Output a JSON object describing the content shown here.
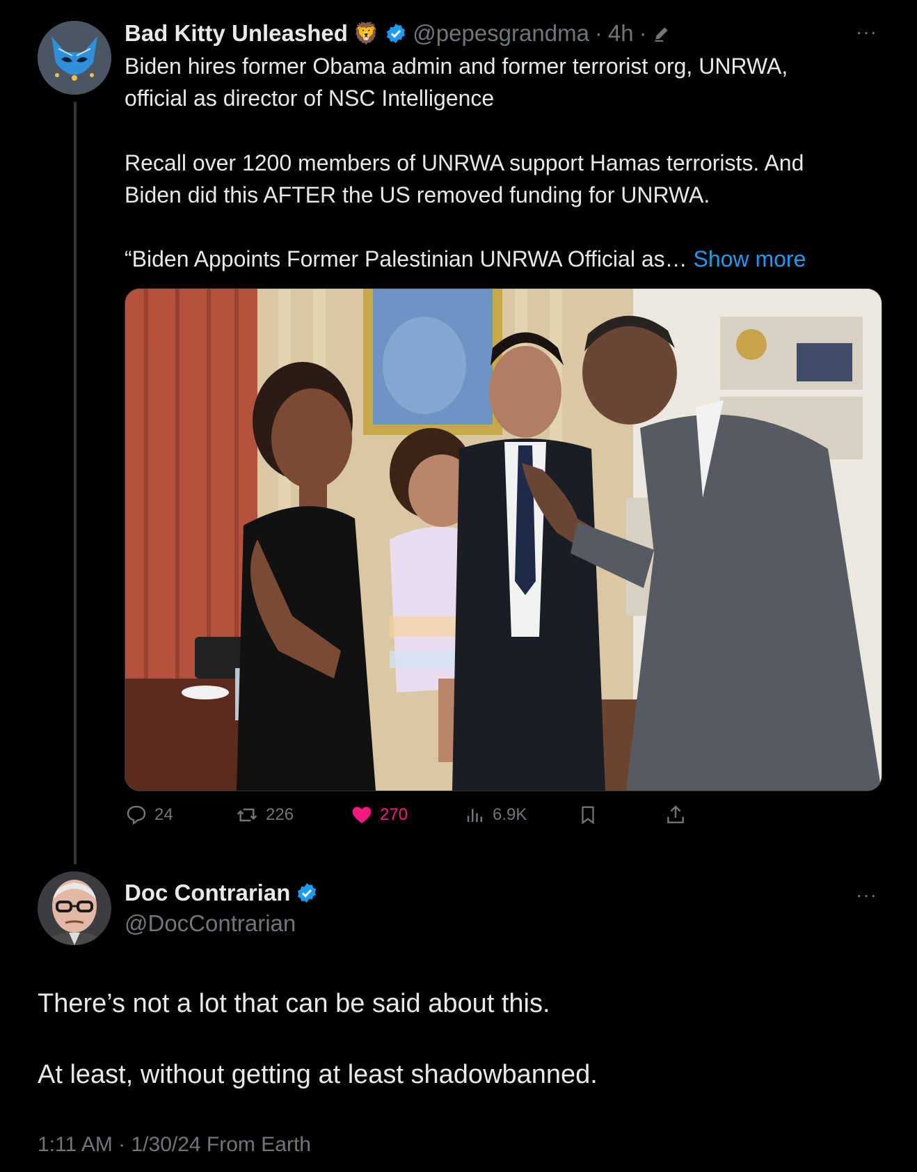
{
  "tweet1": {
    "author_name": "Bad Kitty Unleashed",
    "emoji": "🦁",
    "handle": "@pepesgrandma",
    "time": "4h",
    "sep": "·",
    "more_label": "···",
    "text_p1": "Biden hires former Obama admin and former terrorist org, UNRWA,\nofficial as director of NSC Intelligence",
    "text_p2": "Recall over 1200 members of UNRWA support Hamas terrorists. And\nBiden did this AFTER the US removed funding for UNRWA.",
    "text_p3": "“Biden Appoints Former Palestinian UNRWA Official as…",
    "show_more": "Show more",
    "stats": {
      "replies": "24",
      "reposts": "226",
      "likes": "270",
      "views": "6.9K"
    }
  },
  "tweet2": {
    "author_name": "Doc Contrarian",
    "handle": "@DocContrarian",
    "more_label": "···",
    "text_p1": "There’s not a lot that can be said about this.",
    "text_p2": "At least, without getting at least shadowbanned.",
    "timestamp": "1:11 AM · 1/30/24 From Earth"
  },
  "colors": {
    "background": "#000000",
    "text": "#e7e9ea",
    "secondary": "#71767b",
    "accent": "#1d9bf0",
    "like": "#f91880"
  },
  "icons": [
    "reply-icon",
    "repost-icon",
    "like-icon",
    "views-icon",
    "bookmark-icon",
    "share-icon",
    "verified-icon",
    "edit-icon",
    "more-icon"
  ]
}
